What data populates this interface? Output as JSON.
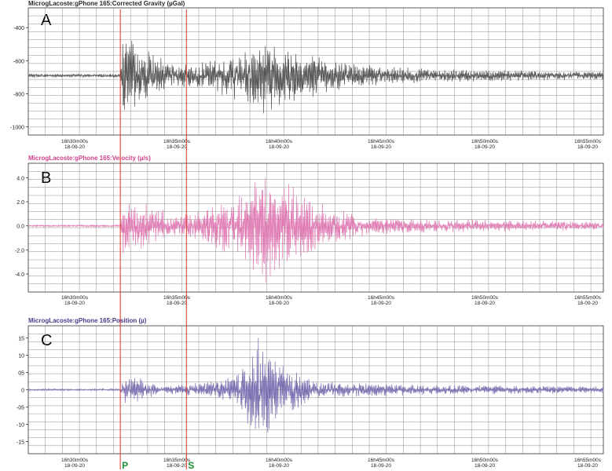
{
  "chart_data": [
    {
      "type": "line",
      "panel_letter": "A",
      "title": "MicrogLacoste:gPhone 165:Corrected Gravity (µGal)",
      "title_color": "#2a2a2a",
      "line_color": "#555555",
      "ylim": [
        -1050,
        -280
      ],
      "yticks": [
        -400,
        -600,
        -800,
        -1000
      ],
      "ytick_labels": [
        "-400",
        "-600",
        "-800",
        "-1000"
      ],
      "baseline": -690,
      "signal": [
        {
          "t": 0.0,
          "amp": 10
        },
        {
          "t": 0.16,
          "amp": 12
        },
        {
          "t": 0.165,
          "amp": 300
        },
        {
          "t": 0.19,
          "amp": 180
        },
        {
          "t": 0.25,
          "amp": 80
        },
        {
          "t": 0.3,
          "amp": 80
        },
        {
          "t": 0.35,
          "amp": 130
        },
        {
          "t": 0.4,
          "amp": 240
        },
        {
          "t": 0.46,
          "amp": 180
        },
        {
          "t": 0.55,
          "amp": 80
        },
        {
          "t": 0.7,
          "amp": 40
        },
        {
          "t": 1.0,
          "amp": 25
        }
      ],
      "x_ticks": [
        {
          "time": "16h30m00s",
          "date": "18-09-20"
        },
        {
          "time": "16h35m00s",
          "date": "18-09-20"
        },
        {
          "time": "16h40m00s",
          "date": "18-09-20"
        },
        {
          "time": "16h45m00s",
          "date": "18-09-20"
        },
        {
          "time": "16h50m00s",
          "date": "18-09-20"
        },
        {
          "time": "16h55m00s",
          "date": "18-09-20"
        }
      ]
    },
    {
      "type": "line",
      "panel_letter": "B",
      "title": "MicrogLacoste:gPhone 165:Velocity (µ/s)",
      "title_color": "#d0408c",
      "line_color": "#e07cb4",
      "ylim": [
        -5.5,
        5.2
      ],
      "yticks": [
        4.0,
        2.0,
        0.0,
        -2.0,
        -4.0
      ],
      "ytick_labels": [
        "4.0",
        "2.0",
        "0.0",
        "-2.0",
        "-4.0"
      ],
      "baseline": 0.0,
      "signal": [
        {
          "t": 0.0,
          "amp": 0.08
        },
        {
          "t": 0.16,
          "amp": 0.1
        },
        {
          "t": 0.165,
          "amp": 3.2
        },
        {
          "t": 0.19,
          "amp": 2.2
        },
        {
          "t": 0.26,
          "amp": 0.9
        },
        {
          "t": 0.32,
          "amp": 1.8
        },
        {
          "t": 0.38,
          "amp": 3.0
        },
        {
          "t": 0.41,
          "amp": 5.0
        },
        {
          "t": 0.45,
          "amp": 3.6
        },
        {
          "t": 0.52,
          "amp": 1.6
        },
        {
          "t": 0.6,
          "amp": 0.7
        },
        {
          "t": 1.0,
          "amp": 0.35
        }
      ],
      "x_ticks": [
        {
          "time": "16h30m00s",
          "date": "18-09-20"
        },
        {
          "time": "16h35m00s",
          "date": "18-09-20"
        },
        {
          "time": "16h40m00s",
          "date": "18-09-20"
        },
        {
          "time": "16h45m00s",
          "date": "18-09-20"
        },
        {
          "time": "16h50m00s",
          "date": "18-09-20"
        },
        {
          "time": "16h55m00s",
          "date": "18-09-20"
        }
      ]
    },
    {
      "type": "line",
      "panel_letter": "C",
      "title": "MicrogLacoste:gPhone 165:Position (µ)",
      "title_color": "#4a3a8a",
      "line_color": "#7a6fb0",
      "ylim": [
        -18.5,
        18.5
      ],
      "yticks": [
        15,
        10,
        5,
        0,
        -5,
        -10,
        -15
      ],
      "ytick_labels": [
        "15",
        "10",
        "05",
        "0",
        "-05",
        "-10",
        "-15"
      ],
      "baseline": 0,
      "signal": [
        {
          "t": 0.0,
          "amp": 0.3
        },
        {
          "t": 0.16,
          "amp": 0.3
        },
        {
          "t": 0.165,
          "amp": 4.5
        },
        {
          "t": 0.19,
          "amp": 4.0
        },
        {
          "t": 0.23,
          "amp": 1.0
        },
        {
          "t": 0.3,
          "amp": 2.2
        },
        {
          "t": 0.36,
          "amp": 4.0
        },
        {
          "t": 0.4,
          "amp": 16.0
        },
        {
          "t": 0.44,
          "amp": 9.0
        },
        {
          "t": 0.5,
          "amp": 2.5
        },
        {
          "t": 0.7,
          "amp": 1.5
        },
        {
          "t": 1.0,
          "amp": 1.0
        }
      ],
      "x_ticks": [
        {
          "time": "16h30m00s",
          "date": "18-09-20"
        },
        {
          "time": "16h35m00s",
          "date": "18-09-20"
        },
        {
          "time": "16h40m00s",
          "date": "18-09-20"
        },
        {
          "time": "16h45m00s",
          "date": "18-09-20"
        },
        {
          "time": "16h50m00s",
          "date": "18-09-20"
        },
        {
          "time": "16h55m00s",
          "date": "18-09-20"
        }
      ]
    }
  ],
  "phase_markers": [
    {
      "label": "P",
      "t": 0.16,
      "line_color": "#e03020",
      "label_color": "#1a8f3a"
    },
    {
      "label": "S",
      "t": 0.275,
      "line_color": "#e03020",
      "label_color": "#1a8f3a"
    }
  ],
  "colors": {
    "grid": "#8c8c8c",
    "frame": "#333333"
  }
}
